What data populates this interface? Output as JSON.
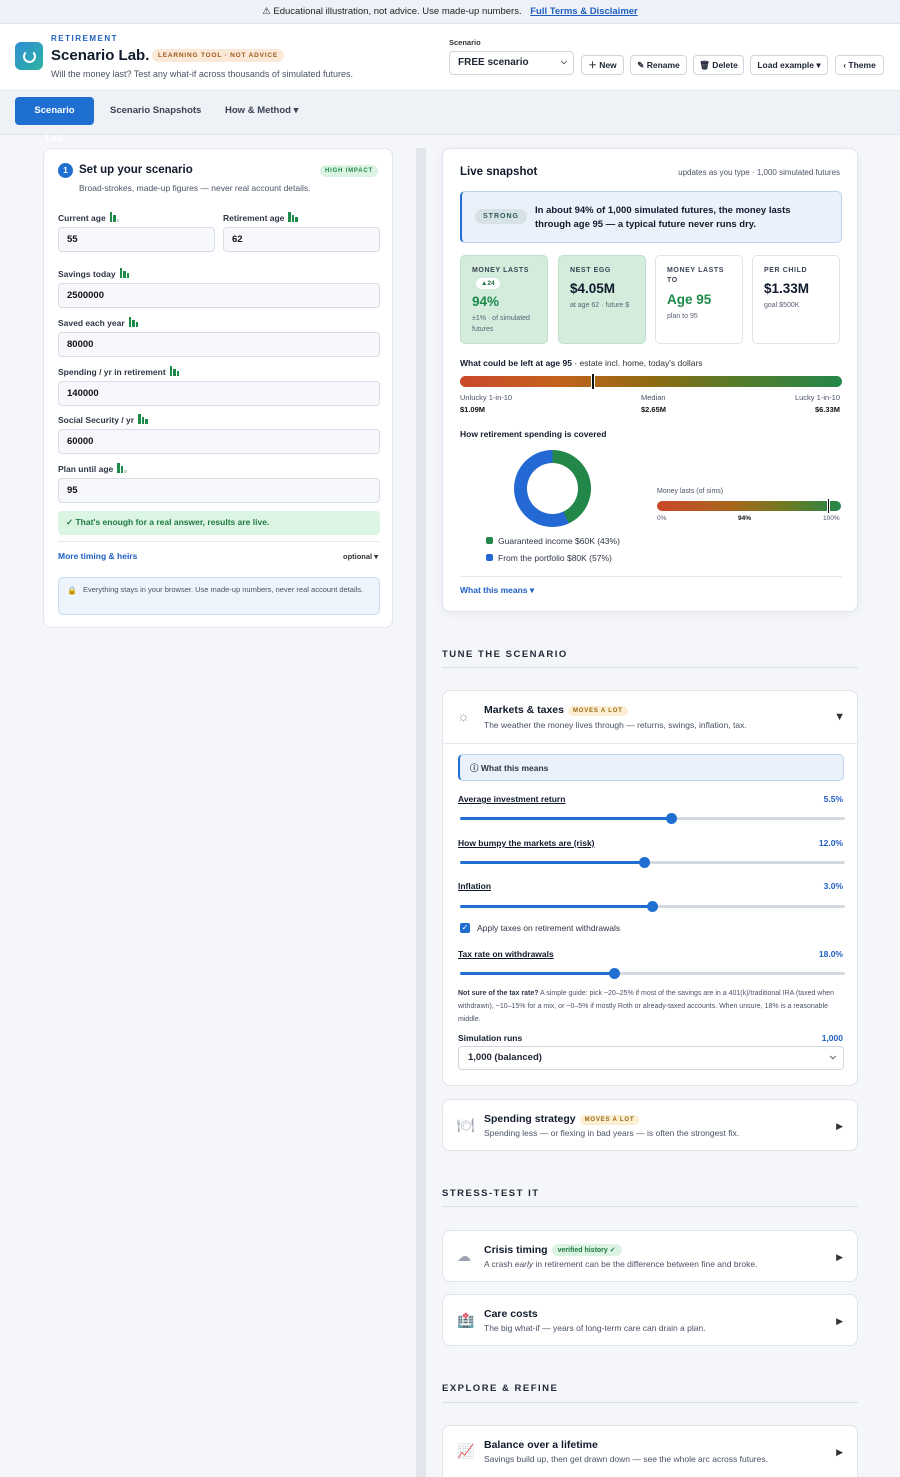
{
  "banner": {
    "text": "⚠ Educational illustration, not advice. Use made-up numbers.",
    "link": "Full Terms & Disclaimer"
  },
  "header": {
    "kicker": "RETIREMENT",
    "title": "Scenario Lab.",
    "badge": "LEARNING TOOL · NOT ADVICE",
    "tagline": "Will the money last? Test any what-if across thousands of simulated futures.",
    "scenario_label": "Scenario",
    "scenario_value": "FREE scenario",
    "buttons": {
      "new": "＋ New",
      "rename": "✎ Rename",
      "delete": "🗑 Delete",
      "load": "Load example ▾",
      "theme": "‹ Theme"
    }
  },
  "nav": {
    "tabs": [
      "Scenario Lab",
      "Scenario Snapshots",
      "How & Method ▾"
    ],
    "active": 0
  },
  "setup": {
    "step": "1",
    "title": "Set up your scenario",
    "badge": "HIGH IMPACT",
    "subtitle": "Broad-strokes, made-up figures — never real account details.",
    "fields": {
      "current_age": {
        "label": "Current age",
        "value": "55"
      },
      "retirement_age": {
        "label": "Retirement age",
        "value": "62"
      },
      "savings": {
        "label": "Savings today",
        "value": "2500000"
      },
      "saved_each_year": {
        "label": "Saved each year",
        "value": "80000"
      },
      "spending": {
        "label": "Spending / yr in retirement",
        "value": "140000"
      },
      "social_security": {
        "label": "Social Security / yr",
        "value": "60000"
      },
      "plan_until": {
        "label": "Plan until age",
        "value": "95"
      }
    },
    "status": "✓ That's enough for a real answer, results are live.",
    "more_link": "More timing & heirs",
    "optional": "optional ▾",
    "privacy": "Everything stays in your browser. Use made-up numbers, never real account details."
  },
  "snapshot": {
    "title": "Live snapshot",
    "meta": "updates as you type · 1,000 simulated futures",
    "verdict_pill": "STRONG",
    "verdict": "In about 94% of 1,000 simulated futures, the money lasts through age 95 — a typical future never runs dry.",
    "kpis": [
      {
        "label": "MONEY LASTS",
        "delta": "▲24",
        "value": "94%",
        "sub": "±1% · of simulated futures"
      },
      {
        "label": "NEST EGG",
        "value": "$4.05M",
        "sub": "at age 62 · future $"
      },
      {
        "label": "MONEY LASTS TO",
        "value": "Age 95",
        "sub": "plan to 95"
      },
      {
        "label": "PER CHILD",
        "value": "$1.33M",
        "sub": "goal $500K"
      }
    ],
    "left_title": "What could be left at age 95",
    "left_note": " · estate incl. home, today's dollars",
    "left_points": [
      {
        "label": "Unlucky 1-in-10",
        "value": "$1.09M"
      },
      {
        "label": "Median",
        "value": "$2.65M"
      },
      {
        "label": "Lucky 1-in-10",
        "value": "$6.33M"
      }
    ],
    "coverage_title": "How retirement spending is covered",
    "coverage": [
      {
        "label": "Guaranteed income $60K (43%)",
        "share": 43,
        "color": "#23874a"
      },
      {
        "label": "From the portfolio $80K (57%)",
        "share": 57,
        "color": "#2468d4"
      }
    ],
    "money_lasts_label": "Money lasts (of sims)",
    "money_lasts_value": 94,
    "money_lasts_ticks": [
      "0%",
      "94%",
      "100%"
    ],
    "what_link": "What this means ▾"
  },
  "tune": {
    "heading": "TUNE THE SCENARIO",
    "markets": {
      "title": "Markets & taxes",
      "pill": "MOVES A LOT",
      "sub": "The weather the money lives through — returns, swings, inflation, tax.",
      "arrow": "▼",
      "what": "ⓘ What this means",
      "sliders": [
        {
          "label": "Average investment return",
          "value": "5.5%",
          "fraction": 0.55
        },
        {
          "label": "How bumpy the markets are (risk)",
          "value": "12.0%",
          "fraction": 0.48
        },
        {
          "label": "Inflation",
          "value": "3.0%",
          "fraction": 0.5
        }
      ],
      "checkbox": "Apply taxes on retirement withdrawals",
      "tax": {
        "label": "Tax rate on withdrawals",
        "value": "18.0%",
        "fraction": 0.4
      },
      "note_bold": "Not sure of the tax rate?",
      "note": " A simple guide: pick ~20–25% if most of the savings are in a 401(k)/traditional IRA (taxed when withdrawn), ~10–15% for a mix, or ~0–5% if mostly Roth or already-taxed accounts. When unsure, 18% is a reasonable middle.",
      "runs_label": "Simulation runs",
      "runs_value": "1,000",
      "runs_select": "1,000 (balanced)"
    },
    "spending": {
      "title": "Spending strategy",
      "pill": "MOVES A LOT",
      "sub": "Spending less — or flexing in bad years — is often the strongest fix.",
      "arrow": "▶"
    }
  },
  "stress": {
    "heading": "STRESS-TEST IT",
    "crisis": {
      "title": "Crisis timing",
      "pill": "verified history ✓",
      "sub_pre": "A crash ",
      "sub_em": "early",
      "sub_post": " in retirement can be the difference between fine and broke.",
      "arrow": "▶"
    },
    "care": {
      "title": "Care costs",
      "sub": "The big what-if — years of long-term care can drain a plan.",
      "arrow": "▶"
    }
  },
  "explore": {
    "heading": "EXPLORE & REFINE",
    "balance": {
      "title": "Balance over a lifetime",
      "sub": "Savings build up, then get drawn down — see the whole arc across futures.",
      "arrow": "▶"
    }
  }
}
